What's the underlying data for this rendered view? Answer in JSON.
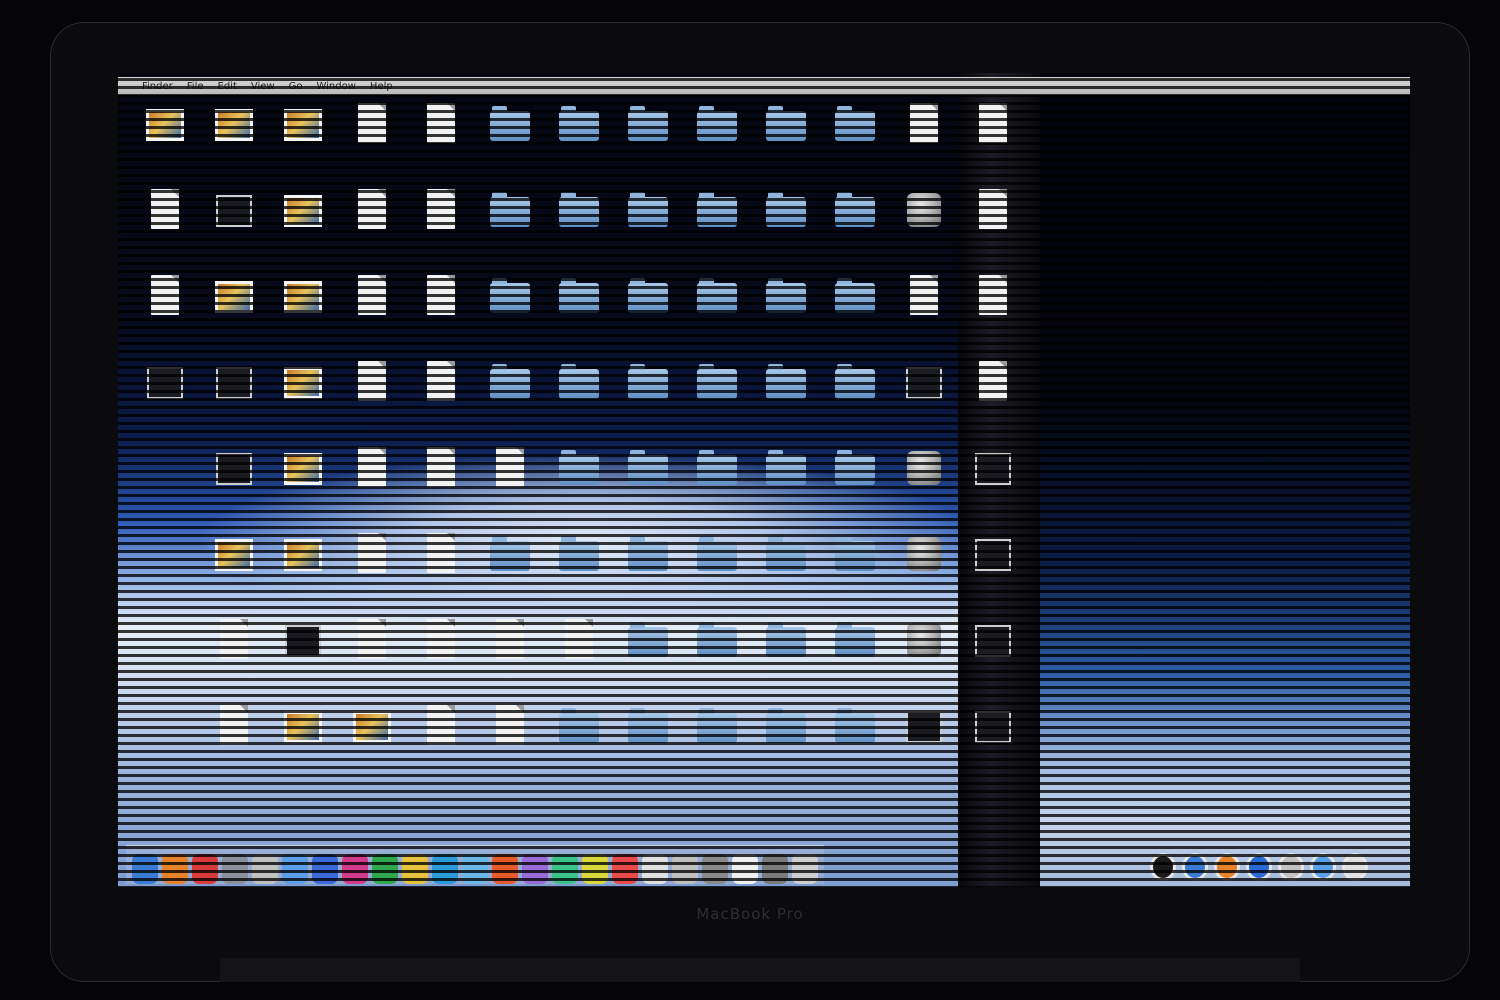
{
  "laptop": {
    "brand": "MacBook Pro"
  },
  "menubar": {
    "apple": "",
    "menus": [
      "Finder",
      "File",
      "Edit",
      "View",
      "Go",
      "Window",
      "Help"
    ],
    "status": [
      "",
      "",
      ""
    ]
  },
  "desktop_items": [
    {
      "type": "image",
      "label": ""
    },
    {
      "type": "image",
      "label": ""
    },
    {
      "type": "image",
      "label": ""
    },
    {
      "type": "doc",
      "label": ""
    },
    {
      "type": "doc",
      "label": ""
    },
    {
      "type": "folder",
      "label": ""
    },
    {
      "type": "folder",
      "label": ""
    },
    {
      "type": "folder",
      "label": ""
    },
    {
      "type": "folder",
      "label": ""
    },
    {
      "type": "folder",
      "label": ""
    },
    {
      "type": "folder",
      "label": ""
    },
    {
      "type": "doc",
      "label": ""
    },
    {
      "type": "doc",
      "label": ""
    },
    {
      "type": "doc",
      "label": ""
    },
    {
      "type": "dark",
      "label": ""
    },
    {
      "type": "image",
      "label": ""
    },
    {
      "type": "doc",
      "label": ""
    },
    {
      "type": "doc",
      "label": ""
    },
    {
      "type": "folder",
      "label": ""
    },
    {
      "type": "folder",
      "label": ""
    },
    {
      "type": "folder",
      "label": ""
    },
    {
      "type": "folder",
      "label": ""
    },
    {
      "type": "folder",
      "label": ""
    },
    {
      "type": "folder",
      "label": ""
    },
    {
      "type": "app",
      "label": ""
    },
    {
      "type": "doc",
      "label": ""
    },
    {
      "type": "doc",
      "label": ""
    },
    {
      "type": "image",
      "label": ""
    },
    {
      "type": "image",
      "label": ""
    },
    {
      "type": "doc",
      "label": ""
    },
    {
      "type": "doc",
      "label": ""
    },
    {
      "type": "folder",
      "label": ""
    },
    {
      "type": "folder",
      "label": ""
    },
    {
      "type": "folder",
      "label": ""
    },
    {
      "type": "folder",
      "label": ""
    },
    {
      "type": "folder",
      "label": ""
    },
    {
      "type": "folder",
      "label": ""
    },
    {
      "type": "doc",
      "label": ""
    },
    {
      "type": "doc",
      "label": ""
    },
    {
      "type": "dark",
      "label": ""
    },
    {
      "type": "dark",
      "label": ""
    },
    {
      "type": "image",
      "label": ""
    },
    {
      "type": "doc",
      "label": ""
    },
    {
      "type": "doc",
      "label": ""
    },
    {
      "type": "folder",
      "label": ""
    },
    {
      "type": "folder",
      "label": ""
    },
    {
      "type": "folder",
      "label": ""
    },
    {
      "type": "folder",
      "label": ""
    },
    {
      "type": "folder",
      "label": ""
    },
    {
      "type": "folder",
      "label": ""
    },
    {
      "type": "dark",
      "label": ""
    },
    {
      "type": "doc",
      "label": ""
    },
    {
      "type": "none",
      "label": ""
    },
    {
      "type": "dark",
      "label": ""
    },
    {
      "type": "image",
      "label": ""
    },
    {
      "type": "doc",
      "label": ""
    },
    {
      "type": "doc",
      "label": ""
    },
    {
      "type": "doc",
      "label": ""
    },
    {
      "type": "folder",
      "label": ""
    },
    {
      "type": "folder",
      "label": ""
    },
    {
      "type": "folder",
      "label": ""
    },
    {
      "type": "folder",
      "label": ""
    },
    {
      "type": "folder",
      "label": ""
    },
    {
      "type": "app",
      "label": ""
    },
    {
      "type": "dark",
      "label": ""
    },
    {
      "type": "none",
      "label": ""
    },
    {
      "type": "image",
      "label": ""
    },
    {
      "type": "image",
      "label": ""
    },
    {
      "type": "doc",
      "label": ""
    },
    {
      "type": "doc",
      "label": ""
    },
    {
      "type": "folder",
      "label": ""
    },
    {
      "type": "folder",
      "label": ""
    },
    {
      "type": "folder",
      "label": ""
    },
    {
      "type": "folder",
      "label": ""
    },
    {
      "type": "folder",
      "label": ""
    },
    {
      "type": "folder",
      "label": ""
    },
    {
      "type": "app",
      "label": ""
    },
    {
      "type": "dark",
      "label": ""
    },
    {
      "type": "none",
      "label": ""
    },
    {
      "type": "doc",
      "label": ""
    },
    {
      "type": "dark",
      "label": ""
    },
    {
      "type": "doc",
      "label": ""
    },
    {
      "type": "doc",
      "label": ""
    },
    {
      "type": "doc",
      "label": ""
    },
    {
      "type": "doc",
      "label": ""
    },
    {
      "type": "folder",
      "label": ""
    },
    {
      "type": "folder",
      "label": ""
    },
    {
      "type": "folder",
      "label": ""
    },
    {
      "type": "folder",
      "label": ""
    },
    {
      "type": "app",
      "label": ""
    },
    {
      "type": "dark",
      "label": ""
    },
    {
      "type": "none",
      "label": ""
    },
    {
      "type": "doc",
      "label": ""
    },
    {
      "type": "image",
      "label": ""
    },
    {
      "type": "image",
      "label": ""
    },
    {
      "type": "doc",
      "label": ""
    },
    {
      "type": "doc",
      "label": ""
    },
    {
      "type": "folder",
      "label": ""
    },
    {
      "type": "folder",
      "label": ""
    },
    {
      "type": "folder",
      "label": ""
    },
    {
      "type": "folder",
      "label": ""
    },
    {
      "type": "folder",
      "label": ""
    },
    {
      "type": "dark",
      "label": ""
    },
    {
      "type": "dark",
      "label": ""
    }
  ],
  "dock_left": [
    "#3a7bd5",
    "#e8822a",
    "#d93b3b",
    "#8a8f99",
    "#c0c0c0",
    "#5aa0e8",
    "#3a6ad8",
    "#d43a8a",
    "#2ea84a",
    "#e8c23a",
    "#2a9ad8",
    "#6ab8e8",
    "#e85a2a",
    "#9a6ad8",
    "#3ac28a",
    "#d8d83a",
    "#e84a4a",
    "#e0e0e0",
    "#bfbfbf",
    "#8a8a8a",
    "#f0f0f0",
    "#7a7a7a",
    "#cfcfcf"
  ],
  "dock_right": [
    "#1a1a1a",
    "#3a7bd5",
    "#e8822a",
    "#2a6ad8",
    "#c0c0c0",
    "#5aa0e8",
    "#e0e0e0"
  ]
}
